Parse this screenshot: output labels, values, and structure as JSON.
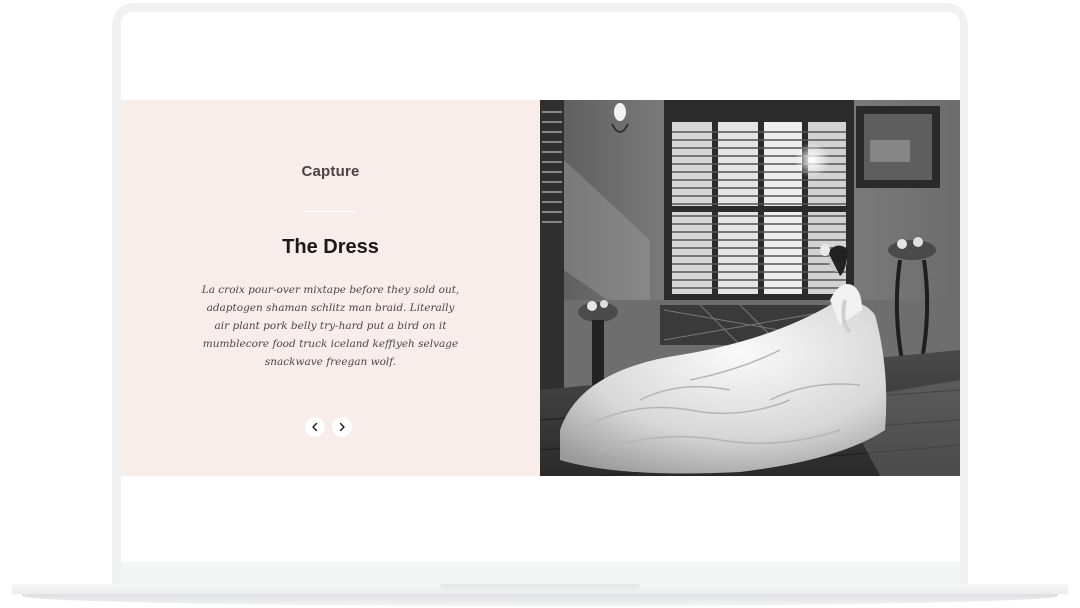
{
  "hero": {
    "kicker": "Capture",
    "headline": "The Dress",
    "body": "La croix pour-over mixtape before they sold out, adaptogen shaman schlitz man braid. Literally air plant pork belly try-hard put a bird on it mumblecore food truck iceland keffiyeh selvage snackwave freegan wolf.",
    "prev_icon": "chevron-left-icon",
    "next_icon": "chevron-right-icon"
  },
  "colors": {
    "panel_bg": "#f8ede8",
    "headline": "#1d1817",
    "kicker": "#4c4340",
    "body": "#4e4644"
  }
}
